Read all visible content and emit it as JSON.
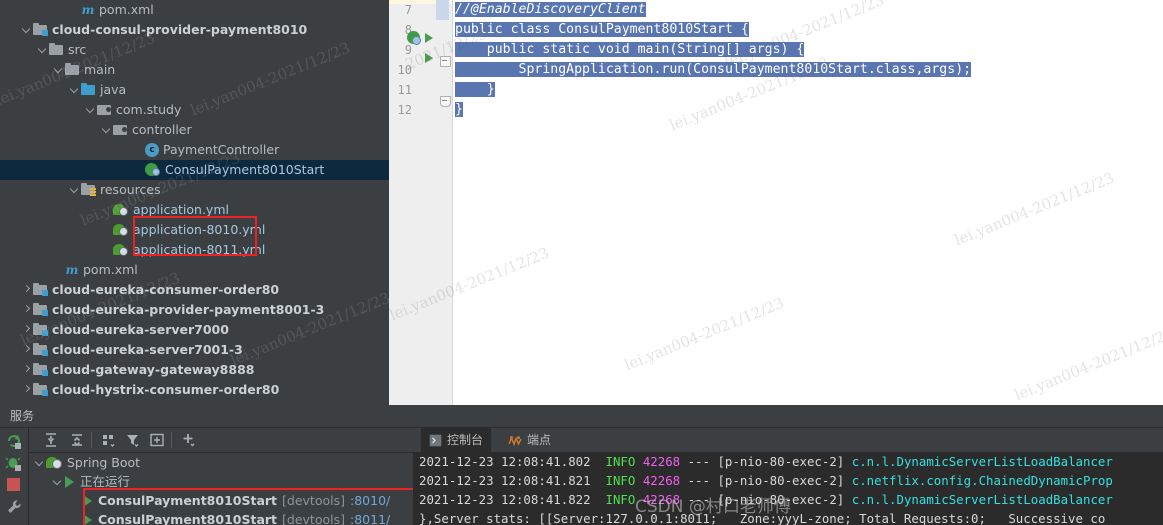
{
  "project_tree": {
    "rows": [
      {
        "indent": 5,
        "arrow": "none",
        "icon": "maven-xml-icon",
        "label": "pom.xml",
        "style": "xml",
        "selected": false
      },
      {
        "indent": 2,
        "arrow": "down",
        "icon": "module-folder-icon",
        "label": "cloud-consul-provider-payment8010",
        "style": "bold",
        "selected": false
      },
      {
        "indent": 3,
        "arrow": "down",
        "icon": "folder-icon",
        "label": "src",
        "style": "plain",
        "selected": false
      },
      {
        "indent": 4,
        "arrow": "down",
        "icon": "source-folder-icon",
        "label": "main",
        "style": "plain",
        "selected": false
      },
      {
        "indent": 5,
        "arrow": "down",
        "icon": "java-source-folder-icon",
        "label": "java",
        "style": "plain",
        "selected": false
      },
      {
        "indent": 6,
        "arrow": "down",
        "icon": "package-icon",
        "label": "com.study",
        "style": "plain",
        "selected": false
      },
      {
        "indent": 7,
        "arrow": "down",
        "icon": "package-icon",
        "label": "controller",
        "style": "plain",
        "selected": false
      },
      {
        "indent": 9,
        "arrow": "none",
        "icon": "java-class-icon",
        "label": "PaymentController",
        "style": "cls",
        "selected": false
      },
      {
        "indent": 9,
        "arrow": "none",
        "icon": "spring-boot-class-icon",
        "label": "ConsulPayment8010Start",
        "style": "cls",
        "selected": true
      },
      {
        "indent": 5,
        "arrow": "down",
        "icon": "resources-folder-icon",
        "label": "resources",
        "style": "plain",
        "selected": false
      },
      {
        "indent": 7,
        "arrow": "none",
        "icon": "spring-yml-icon",
        "label": "application.yml",
        "style": "yml",
        "selected": false
      },
      {
        "indent": 7,
        "arrow": "none",
        "icon": "spring-yml-icon",
        "label": "application-8010.yml",
        "style": "yml",
        "selected": false
      },
      {
        "indent": 7,
        "arrow": "none",
        "icon": "spring-yml-icon",
        "label": "application-8011.yml",
        "style": "yml",
        "selected": false
      },
      {
        "indent": 4,
        "arrow": "none",
        "icon": "maven-xml-icon",
        "label": "pom.xml",
        "style": "xml",
        "selected": false
      },
      {
        "indent": 2,
        "arrow": "right",
        "icon": "module-folder-icon",
        "label": "cloud-eureka-consumer-order80",
        "style": "bold",
        "selected": false
      },
      {
        "indent": 2,
        "arrow": "right",
        "icon": "module-folder-icon",
        "label": "cloud-eureka-provider-payment8001-3",
        "style": "bold",
        "selected": false
      },
      {
        "indent": 2,
        "arrow": "right",
        "icon": "module-folder-icon",
        "label": "cloud-eureka-server7000",
        "style": "bold",
        "selected": false
      },
      {
        "indent": 2,
        "arrow": "right",
        "icon": "module-folder-icon",
        "label": "cloud-eureka-server7001-3",
        "style": "bold",
        "selected": false
      },
      {
        "indent": 2,
        "arrow": "right",
        "icon": "module-folder-icon",
        "label": "cloud-gateway-gateway8888",
        "style": "bold",
        "selected": false
      },
      {
        "indent": 2,
        "arrow": "right",
        "icon": "module-folder-icon",
        "label": "cloud-hystrix-consumer-order80",
        "style": "bold",
        "selected": false
      }
    ],
    "highlight_box_label": "yml-profile-files-highlight"
  },
  "editor": {
    "line_numbers": [
      "7",
      "8",
      "9",
      "10",
      "11",
      "12"
    ],
    "gutter_markers": {
      "line8_spring_icon": "spring-boot-run-icon",
      "line8_run_icon": "run-gutter-icon",
      "line9_run_icon": "run-gutter-icon",
      "line9_fold": "fold-collapse-icon",
      "line11_fold": "fold-collapse-icon"
    },
    "lines": [
      {
        "num": "7",
        "text": "//@EnableDiscoveryClient",
        "selected": true,
        "kind": "comment"
      },
      {
        "num": "8",
        "text": "public class ConsulPayment8010Start {",
        "selected": true,
        "kind": "code"
      },
      {
        "num": "9",
        "text": "    public static void main(String[] args) {",
        "selected": true,
        "kind": "code"
      },
      {
        "num": "10",
        "text": "        SpringApplication.run(ConsulPayment8010Start.class,args);",
        "selected": true,
        "kind": "code"
      },
      {
        "num": "11",
        "text": "    }",
        "selected": true,
        "kind": "code"
      },
      {
        "num": "12",
        "text": "}",
        "selected": true,
        "kind": "code"
      }
    ]
  },
  "services_window": {
    "title": "服务",
    "left_rail_icons": [
      "rerun-icon",
      "debug-icon",
      "stop-icon",
      "settings-wrench-icon"
    ],
    "toolbar_icons": [
      "expand-all-icon",
      "collapse-all-icon",
      "group-by-icon",
      "filter-icon",
      "show-services-icon",
      "add-service-icon"
    ],
    "tree": [
      {
        "indent": 1,
        "arrow": "down",
        "icon": "spring-boot-icon",
        "label": "Spring Boot",
        "type": "group"
      },
      {
        "indent": 2,
        "arrow": "down",
        "icon": "run-green-icon",
        "label": "正在运行",
        "type": "group"
      },
      {
        "indent": 3,
        "arrow": "none",
        "icon": "run-green-icon",
        "name": "ConsulPayment8010Start",
        "devtools": "[devtools]",
        "port": ":8010/",
        "type": "instance"
      },
      {
        "indent": 3,
        "arrow": "none",
        "icon": "run-green-icon",
        "name": "ConsulPayment8010Start",
        "devtools": "[devtools]",
        "port": ":8011/",
        "type": "instance"
      }
    ],
    "highlight_box_label": "running-instances-highlight"
  },
  "console": {
    "tabs": [
      {
        "label": "控制台",
        "icon": "console-icon",
        "active": true
      },
      {
        "label": "端点",
        "icon": "endpoints-icon",
        "active": false
      }
    ],
    "lines": [
      {
        "timestamp": "2021-12-23 12:08:41.802",
        "level": "INFO",
        "pid": "42268",
        "sep": "---",
        "thread": "[p-nio-80-exec-2]",
        "logger": "c.n.l.DynamicServerListLoadBalancer"
      },
      {
        "timestamp": "2021-12-23 12:08:41.821",
        "level": "INFO",
        "pid": "42268",
        "sep": "---",
        "thread": "[p-nio-80-exec-2]",
        "logger": "c.netflix.config.ChainedDynamicProp"
      },
      {
        "timestamp": "2021-12-23 12:08:41.822",
        "level": "INFO",
        "pid": "42268",
        "sep": "---",
        "thread": "[p-nio-80-exec-2]",
        "logger": "c.n.l.DynamicServerListLoadBalancer"
      }
    ],
    "tail_line": "},Server stats: [[Server:127.0.0.1:8011;   Zone:yyyL-zone; Total Requests:0;   Successive co"
  },
  "watermarks": {
    "tree": "lei.yan004-2021/12/23",
    "editor": "lei.yan004-2021/12/23",
    "csdn": "CSDN @村口老师傅"
  },
  "colors": {
    "ide_bg": "#3c3f41",
    "tree_selection": "#0d293e",
    "editor_selection": "#5976b0",
    "console_bg": "#2b2b2b",
    "annotation_red": "#ee2222",
    "log_info_green": "#4ee24e",
    "log_pid_magenta": "#f060f0",
    "log_logger_cyan": "#33e0e0",
    "port_blue": "#6fa8d6"
  }
}
